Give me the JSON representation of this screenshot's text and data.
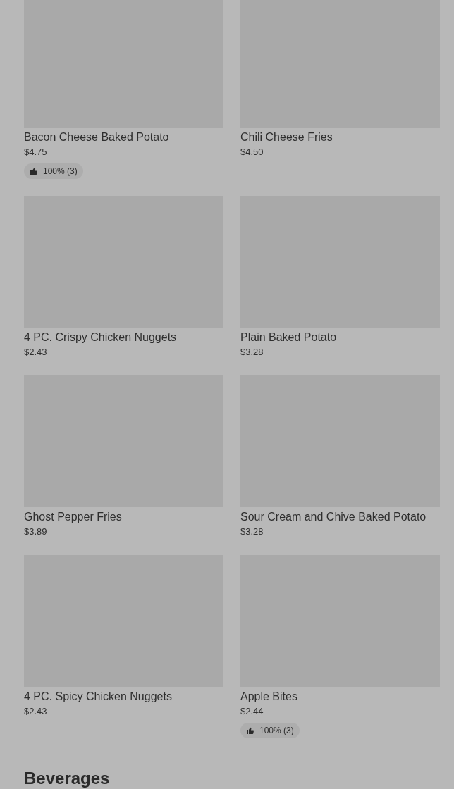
{
  "items": [
    {
      "name": "Bacon Cheese Baked Potato",
      "price": "$4.75",
      "rating": "100% (3)"
    },
    {
      "name": "Chili Cheese Fries",
      "price": "$4.50"
    },
    {
      "name": "4 PC. Crispy Chicken Nuggets",
      "price": "$2.43"
    },
    {
      "name": "Plain Baked Potato",
      "price": "$3.28"
    },
    {
      "name": "Ghost Pepper Fries",
      "price": "$3.89"
    },
    {
      "name": "Sour Cream and Chive Baked Potato",
      "price": "$3.28"
    },
    {
      "name": "4 PC. Spicy Chicken Nuggets",
      "price": "$2.43"
    },
    {
      "name": "Apple Bites",
      "price": "$2.44",
      "rating": "100% (3)"
    }
  ],
  "next_section": {
    "title": "Beverages"
  }
}
